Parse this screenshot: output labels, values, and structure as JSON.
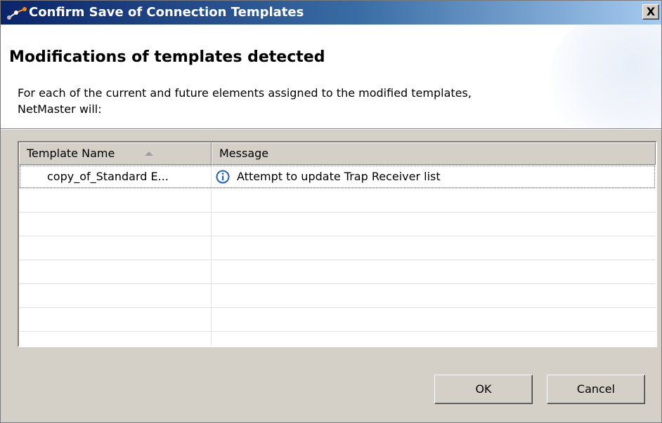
{
  "window": {
    "title": "Confirm Save of Connection Templates",
    "close_label": "X"
  },
  "header": {
    "title": "Modifications of templates detected",
    "description": "For each of the current and future elements assigned to the modified templates, NetMaster will:"
  },
  "table": {
    "columns": [
      "Template Name",
      "Message"
    ],
    "sort_column": "Template Name",
    "sort_direction": "ascending",
    "rows": [
      {
        "template_name": "copy_of_Standard E...",
        "message": "Attempt to update Trap Receiver list",
        "message_icon": "info-icon"
      }
    ]
  },
  "buttons": {
    "ok": "OK",
    "cancel": "Cancel"
  },
  "colors": {
    "titlebar_start": "#0a246a",
    "titlebar_end": "#a6caf0",
    "dialog_bg": "#d4d0c8",
    "info_icon": "#1f5fbf"
  }
}
